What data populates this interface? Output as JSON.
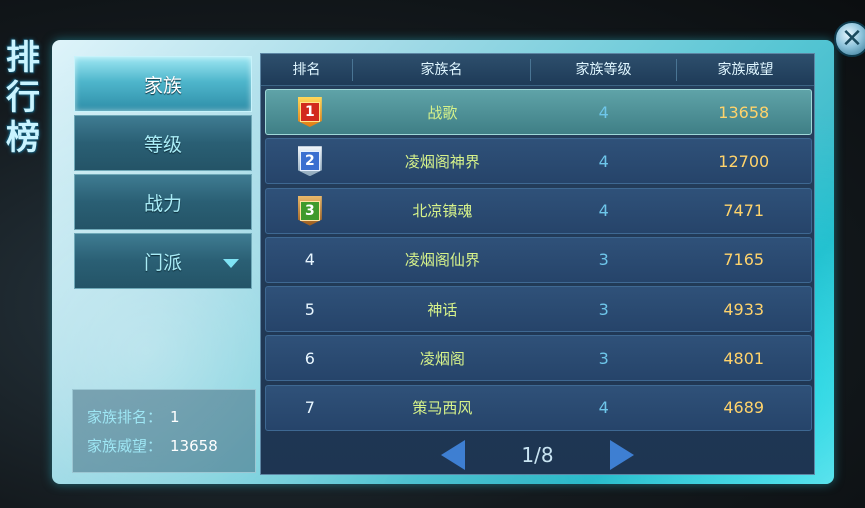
{
  "title_chars": [
    "排",
    "行",
    "榜"
  ],
  "menu": [
    {
      "label": "家族",
      "active": true
    },
    {
      "label": "等级",
      "active": false
    },
    {
      "label": "战力",
      "active": false
    },
    {
      "label": "门派",
      "active": false,
      "dropdown": true
    }
  ],
  "table": {
    "headers": [
      "排名",
      "家族名",
      "家族等级",
      "家族威望"
    ],
    "rows": [
      {
        "rank": "1",
        "medal": "gold",
        "name": "战歌",
        "level": "4",
        "prestige": "13658"
      },
      {
        "rank": "2",
        "medal": "silver",
        "name": "凌烟阁神界",
        "level": "4",
        "prestige": "12700"
      },
      {
        "rank": "3",
        "medal": "bronze",
        "name": "北凉镇魂",
        "level": "4",
        "prestige": "7471"
      },
      {
        "rank": "4",
        "name": "凌烟阁仙界",
        "level": "3",
        "prestige": "7165"
      },
      {
        "rank": "5",
        "name": "神话",
        "level": "3",
        "prestige": "4933"
      },
      {
        "rank": "6",
        "name": "凌烟阁",
        "level": "3",
        "prestige": "4801"
      },
      {
        "rank": "7",
        "name": "策马西风",
        "level": "4",
        "prestige": "4689"
      }
    ]
  },
  "pager": {
    "text": "1/8"
  },
  "info": {
    "rank_label": "家族排名：",
    "rank_value": "1",
    "prestige_label": "家族威望：",
    "prestige_value": "13658"
  },
  "close_symbol": "✕",
  "colors": {
    "accent": "#58c6d4",
    "name": "#d6f28a",
    "prestige": "#ffd36b",
    "level": "#6ec6ea"
  }
}
